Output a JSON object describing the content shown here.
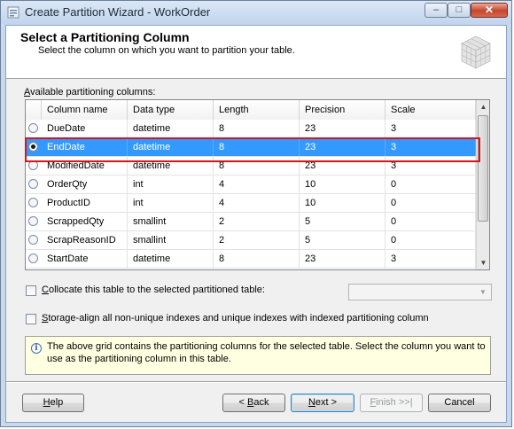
{
  "window": {
    "title": "Create Partition Wizard - WorkOrder",
    "controls": {
      "minimize": "‒",
      "maximize": "□",
      "close": "✕"
    }
  },
  "header": {
    "title": "Select a Partitioning Column",
    "subtitle": "Select the column on which you want to partition your table."
  },
  "grid": {
    "label_prefix": "",
    "label_access": "A",
    "label_rest": "vailable partitioning columns:",
    "columns": [
      "Column name",
      "Data type",
      "Length",
      "Precision",
      "Scale"
    ],
    "rows": [
      {
        "selected": false,
        "name": "DueDate",
        "type": "datetime",
        "length": "8",
        "precision": "23",
        "scale": "3"
      },
      {
        "selected": true,
        "name": "EndDate",
        "type": "datetime",
        "length": "8",
        "precision": "23",
        "scale": "3"
      },
      {
        "selected": false,
        "name": "ModifiedDate",
        "type": "datetime",
        "length": "8",
        "precision": "23",
        "scale": "3"
      },
      {
        "selected": false,
        "name": "OrderQty",
        "type": "int",
        "length": "4",
        "precision": "10",
        "scale": "0"
      },
      {
        "selected": false,
        "name": "ProductID",
        "type": "int",
        "length": "4",
        "precision": "10",
        "scale": "0"
      },
      {
        "selected": false,
        "name": "ScrappedQty",
        "type": "smallint",
        "length": "2",
        "precision": "5",
        "scale": "0"
      },
      {
        "selected": false,
        "name": "ScrapReasonID",
        "type": "smallint",
        "length": "2",
        "precision": "5",
        "scale": "0"
      },
      {
        "selected": false,
        "name": "StartDate",
        "type": "datetime",
        "length": "8",
        "precision": "23",
        "scale": "3"
      }
    ]
  },
  "options": {
    "collocate": {
      "access": "C",
      "rest": "ollocate this table to the selected partitioned table:",
      "checked": false,
      "combo_value": ""
    },
    "storage_align": {
      "access": "S",
      "rest": "torage-align all non-unique indexes and unique indexes with indexed partitioning column",
      "checked": false
    }
  },
  "info": {
    "icon": "info-icon",
    "text": "The above grid contains the partitioning columns for the selected table. Select the column you want to use as the partitioning column in this table."
  },
  "buttons": {
    "help": {
      "access": "H",
      "rest": "elp"
    },
    "back": {
      "pre": "< ",
      "access": "B",
      "rest": "ack"
    },
    "next": {
      "access": "N",
      "rest": "ext >"
    },
    "finish": {
      "access": "F",
      "rest": "inish >>|"
    },
    "cancel": {
      "label": "Cancel"
    }
  },
  "colors": {
    "selection": "#3399ff",
    "highlight_box": "#d8141f",
    "info_background": "#ffffe1"
  }
}
